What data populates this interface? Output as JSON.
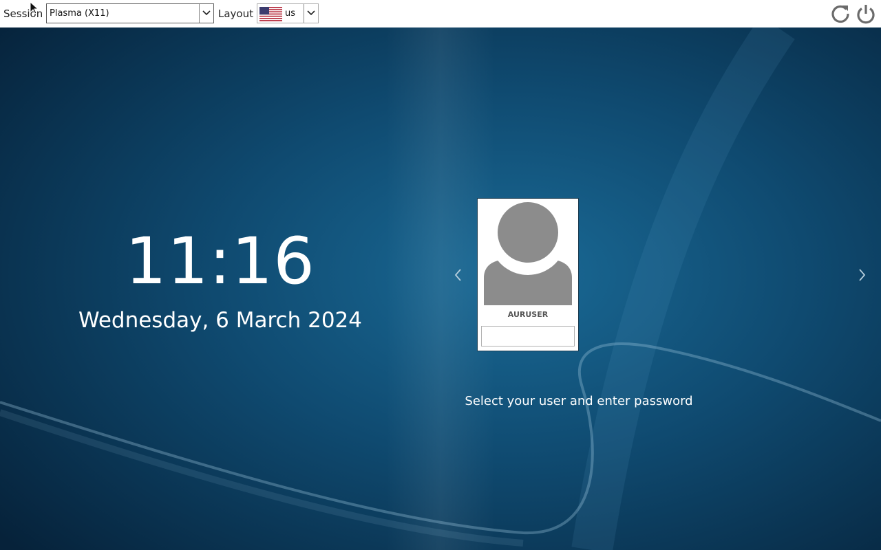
{
  "topbar": {
    "session_label": "Session",
    "session_value": "Plasma (X11)",
    "layout_label": "Layout",
    "layout_value": "us",
    "restart_icon": "restart-icon",
    "shutdown_icon": "power-icon"
  },
  "clock": {
    "time": "11:16",
    "date": "Wednesday, 6 March 2024"
  },
  "user": {
    "name": "AURUSER",
    "password_value": ""
  },
  "hint": "Select your user and enter password",
  "colors": {
    "background_dark": "#07263b",
    "background_mid": "#145a82",
    "text": "#ffffff",
    "icon_gray": "#6b6b6b"
  }
}
